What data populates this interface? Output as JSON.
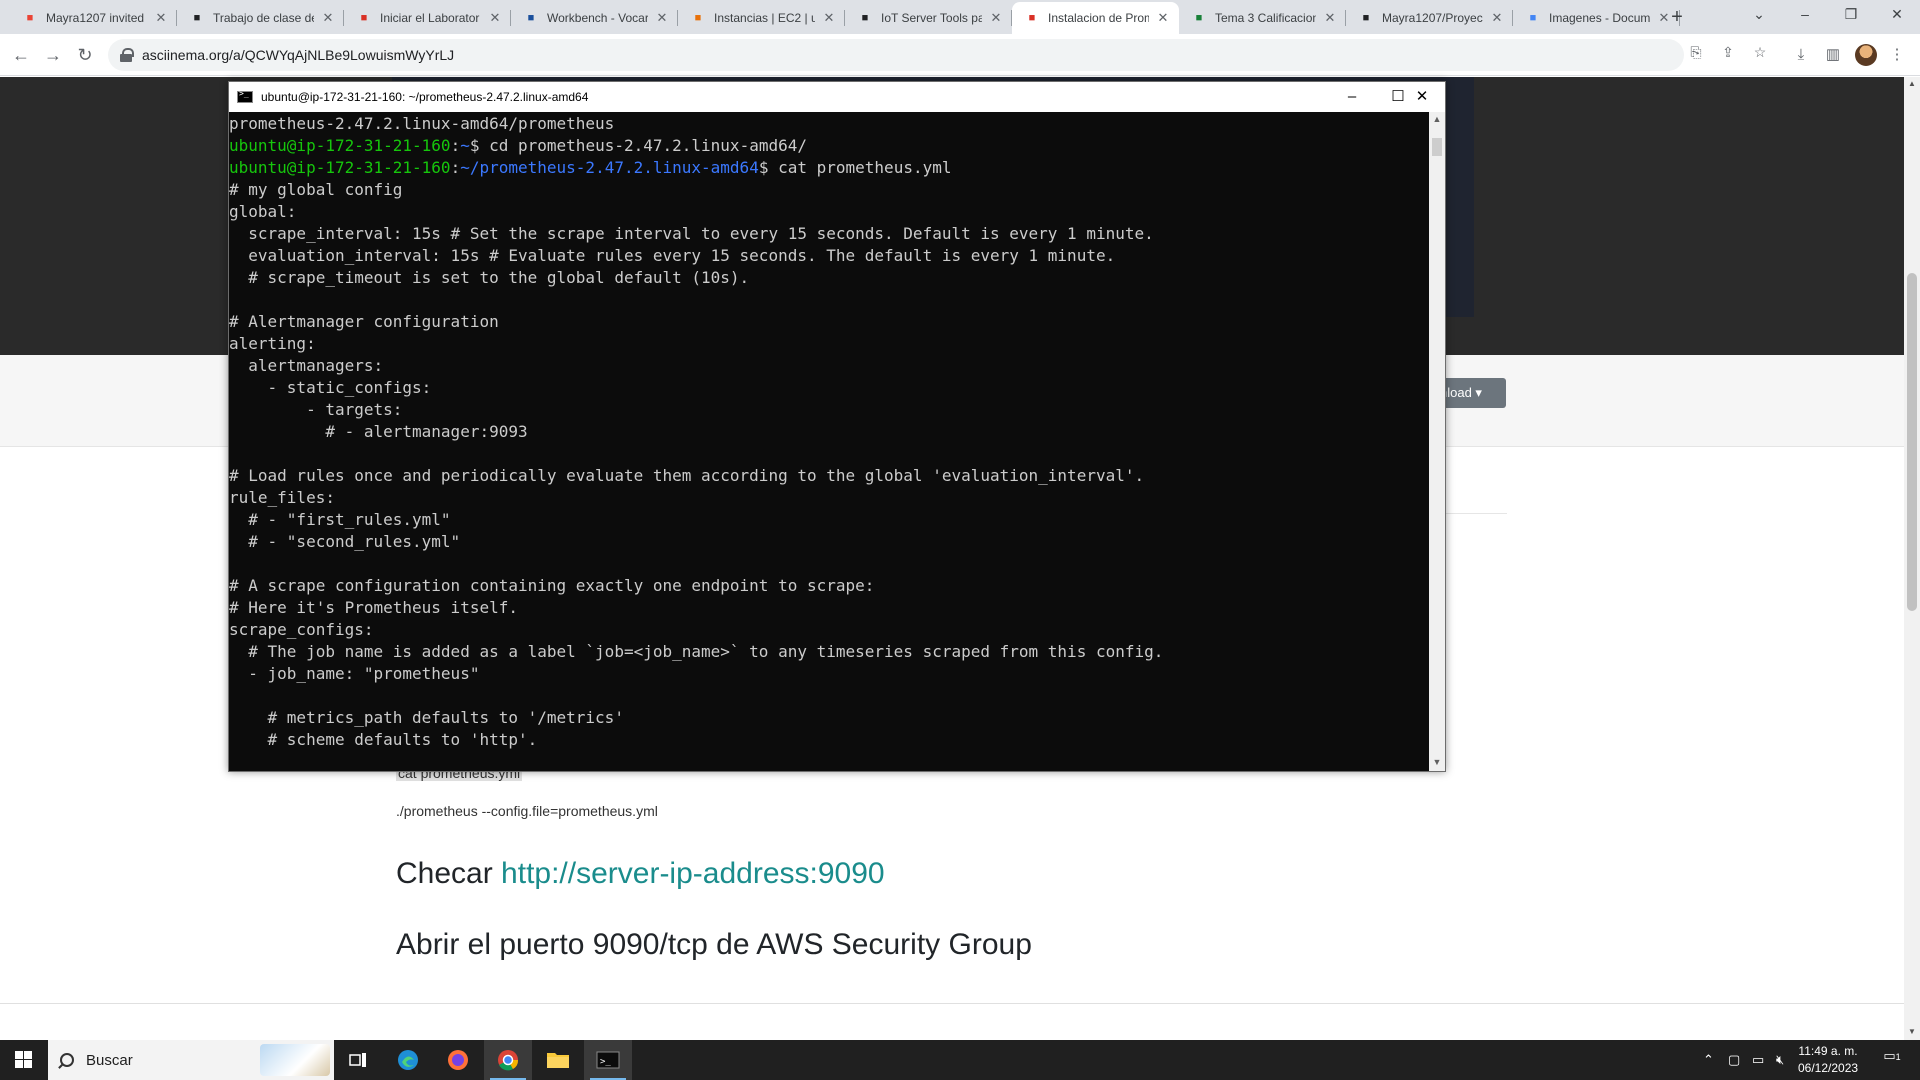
{
  "browser": {
    "tabs": [
      {
        "title": "Mayra1207 invited",
        "favicon": "gmail-icon",
        "color": "#ea4335"
      },
      {
        "title": "Trabajo de clase de",
        "favicon": "classroom-icon",
        "color": "#202124"
      },
      {
        "title": "Iniciar el Laborator",
        "favicon": "loading-icon",
        "color": "#d93025"
      },
      {
        "title": "Workbench - Vocar",
        "favicon": "vocareum-icon",
        "color": "#1a4f9c"
      },
      {
        "title": "Instancias | EC2 | u",
        "favicon": "aws-icon",
        "color": "#e8710a"
      },
      {
        "title": "IoT Server Tools pa",
        "favicon": "classroom-icon",
        "color": "#202124"
      },
      {
        "title": "Instalacion de Prom",
        "favicon": "asciinema-icon",
        "color": "#d93025",
        "active": true
      },
      {
        "title": "Tema 3 Calificacion",
        "favicon": "sheets-icon",
        "color": "#188038"
      },
      {
        "title": "Mayra1207/Proyec",
        "favicon": "github-icon",
        "color": "#202124"
      },
      {
        "title": "Imagenes - Docum",
        "favicon": "docs-icon",
        "color": "#4285f4"
      }
    ],
    "url": "asciinema.org/a/QCWYqAjNLBe9LowuismWyYrLJ"
  },
  "page": {
    "download_label": "nload",
    "code_highlight": "cat prometheus.yml",
    "command_line": "./prometheus --config.file=prometheus.yml",
    "checar_prefix": "Checar ",
    "checar_link": "http://server-ip-address:9090",
    "abrir_heading": "Abrir el puerto 9090/tcp de AWS Security Group"
  },
  "terminal": {
    "title": "ubuntu@ip-172-31-21-160: ~/prometheus-2.47.2.linux-amd64",
    "lines": [
      {
        "plain": "prometheus-2.47.2.linux-amd64/prometheus"
      },
      {
        "user": "ubuntu@ip-172-31-21-160",
        "path": "~",
        "cmd": "$ cd prometheus-2.47.2.linux-amd64/"
      },
      {
        "user": "ubuntu@ip-172-31-21-160",
        "path": "~/prometheus-2.47.2.linux-amd64",
        "cmd": "$ cat prometheus.yml"
      },
      {
        "plain": "# my global config"
      },
      {
        "plain": "global:"
      },
      {
        "plain": "  scrape_interval: 15s # Set the scrape interval to every 15 seconds. Default is every 1 minute."
      },
      {
        "plain": "  evaluation_interval: 15s # Evaluate rules every 15 seconds. The default is every 1 minute."
      },
      {
        "plain": "  # scrape_timeout is set to the global default (10s)."
      },
      {
        "plain": ""
      },
      {
        "plain": "# Alertmanager configuration"
      },
      {
        "plain": "alerting:"
      },
      {
        "plain": "  alertmanagers:"
      },
      {
        "plain": "    - static_configs:"
      },
      {
        "plain": "        - targets:"
      },
      {
        "plain": "          # - alertmanager:9093"
      },
      {
        "plain": ""
      },
      {
        "plain": "# Load rules once and periodically evaluate them according to the global 'evaluation_interval'."
      },
      {
        "plain": "rule_files:"
      },
      {
        "plain": "  # - \"first_rules.yml\""
      },
      {
        "plain": "  # - \"second_rules.yml\""
      },
      {
        "plain": ""
      },
      {
        "plain": "# A scrape configuration containing exactly one endpoint to scrape:"
      },
      {
        "plain": "# Here it's Prometheus itself."
      },
      {
        "plain": "scrape_configs:"
      },
      {
        "plain": "  # The job name is added as a label `job=<job_name>` to any timeseries scraped from this config."
      },
      {
        "plain": "  - job_name: \"prometheus\""
      },
      {
        "plain": ""
      },
      {
        "plain": "    # metrics_path defaults to '/metrics'"
      },
      {
        "plain": "    # scheme defaults to 'http'."
      }
    ]
  },
  "taskbar": {
    "search_placeholder": "Buscar",
    "time": "11:49 a. m.",
    "date": "06/12/2023",
    "notification_count": "1"
  }
}
